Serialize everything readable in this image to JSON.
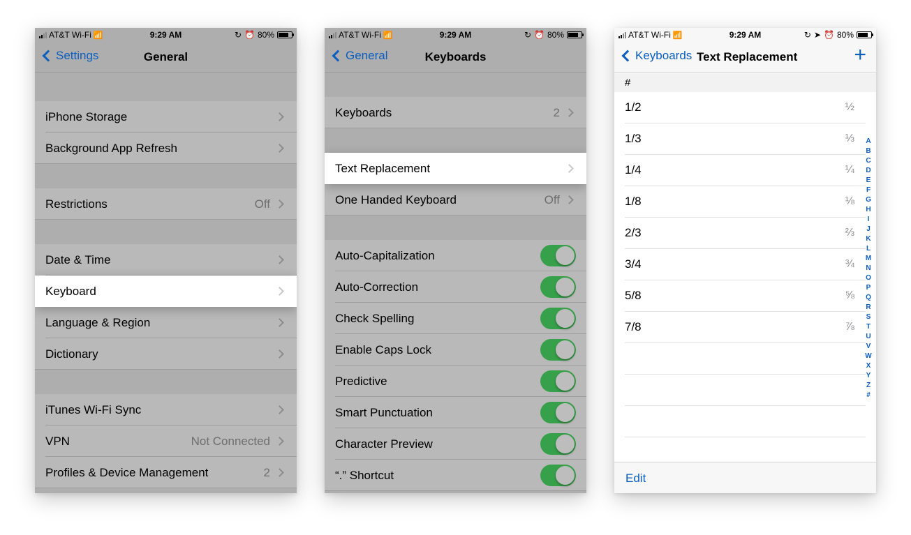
{
  "status": {
    "carrier": "AT&T Wi-Fi",
    "time": "9:29 AM",
    "battery": "80%"
  },
  "screens": [
    {
      "back": "Settings",
      "title": "General",
      "rows": [
        {
          "label": "iPhone Storage"
        },
        {
          "label": "Background App Refresh"
        },
        {
          "label": "Restrictions",
          "detail": "Off"
        },
        {
          "label": "Date & Time"
        },
        {
          "label": "Keyboard"
        },
        {
          "label": "Language & Region"
        },
        {
          "label": "Dictionary"
        },
        {
          "label": "iTunes Wi-Fi Sync"
        },
        {
          "label": "VPN",
          "detail": "Not Connected"
        },
        {
          "label": "Profiles & Device Management",
          "detail": "2"
        }
      ]
    },
    {
      "back": "General",
      "title": "Keyboards",
      "rows": [
        {
          "label": "Keyboards",
          "detail": "2"
        },
        {
          "label": "Text Replacement"
        },
        {
          "label": "One Handed Keyboard",
          "detail": "Off"
        },
        {
          "label": "Auto-Capitalization",
          "toggle": true
        },
        {
          "label": "Auto-Correction",
          "toggle": true
        },
        {
          "label": "Check Spelling",
          "toggle": true
        },
        {
          "label": "Enable Caps Lock",
          "toggle": true
        },
        {
          "label": "Predictive",
          "toggle": true
        },
        {
          "label": "Smart Punctuation",
          "toggle": true
        },
        {
          "label": "Character Preview",
          "toggle": true
        },
        {
          "label": "“.” Shortcut",
          "toggle": true
        }
      ]
    },
    {
      "back": "Keyboards",
      "title": "Text Replacement",
      "add_icon": "plus-icon",
      "section": "#",
      "entries": [
        {
          "shortcut": "1/2",
          "phrase": "½"
        },
        {
          "shortcut": "1/3",
          "phrase": "⅓"
        },
        {
          "shortcut": "1/4",
          "phrase": "¼"
        },
        {
          "shortcut": "1/8",
          "phrase": "⅛"
        },
        {
          "shortcut": "2/3",
          "phrase": "⅔"
        },
        {
          "shortcut": "3/4",
          "phrase": "¾"
        },
        {
          "shortcut": "5/8",
          "phrase": "⅝"
        },
        {
          "shortcut": "7/8",
          "phrase": "⅞"
        }
      ],
      "index": [
        "A",
        "B",
        "C",
        "D",
        "E",
        "F",
        "G",
        "H",
        "I",
        "J",
        "K",
        "L",
        "M",
        "N",
        "O",
        "P",
        "Q",
        "R",
        "S",
        "T",
        "U",
        "V",
        "W",
        "X",
        "Y",
        "Z",
        "#"
      ],
      "edit": "Edit"
    }
  ],
  "colors": {
    "accent": "#0a5ec0",
    "toggle_on": "#37a04a",
    "dimmed_bg": "#b9b9b9"
  }
}
